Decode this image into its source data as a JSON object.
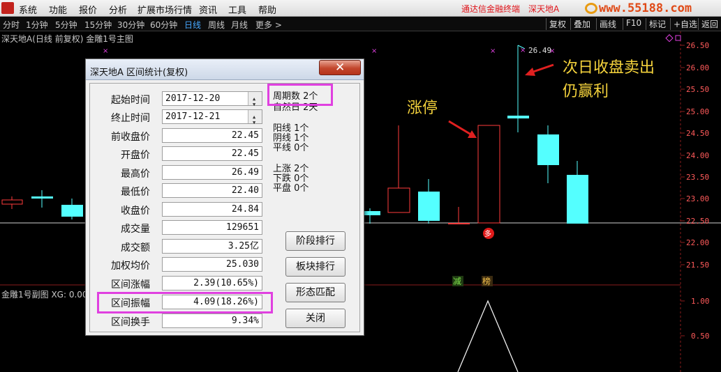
{
  "menu": {
    "items": [
      "系统",
      "功能",
      "报价",
      "分析",
      "扩展市场行情",
      "资讯",
      "工具",
      "帮助"
    ],
    "brand_links": [
      "通达信金融终端",
      "深天地A"
    ],
    "site_watermark": "www.55188.com"
  },
  "period_bar": {
    "periods": [
      "分时",
      "1分钟",
      "5分钟",
      "15分钟",
      "30分钟",
      "60分钟",
      "日线",
      "周线",
      "月线",
      "更多 >"
    ],
    "active_period": "日线",
    "tools": [
      "复权",
      "叠加",
      "画线",
      "F10",
      "标记",
      "+自选",
      "返回"
    ]
  },
  "chart": {
    "main_title": "深天地A(日线 前复权) 金雕1号主图",
    "sub_title": "金雕1号副图 XG: 0.00",
    "price_axis": [
      "26.50",
      "26.00",
      "25.50",
      "25.00",
      "24.50",
      "24.00",
      "23.50",
      "23.00",
      "22.50",
      "22.00",
      "21.50"
    ],
    "sub_axis": [
      "1.00",
      "0.50"
    ],
    "high_label": "26.49",
    "signal_duo": "多",
    "signal_jian": "减",
    "signal_bang": "榜",
    "colors": {
      "up": "#ff3c3c",
      "down": "#54ffff",
      "axis_text": "#ff5a5a",
      "signal_marker": "#e040e0"
    }
  },
  "annotations": {
    "limit_up": "涨停",
    "next_day_line1": "次日收盘卖出",
    "next_day_line2": "仍赢利"
  },
  "dialog": {
    "title": "深天地A 区间统计(复权)",
    "close_label": "✕",
    "start_label": "起始时间",
    "start_value": "2017-12-20",
    "end_label": "终止时间",
    "end_value": "2017-12-21",
    "fields": [
      {
        "label": "前收盘价",
        "value": "22.45"
      },
      {
        "label": "开盘价",
        "value": "22.45"
      },
      {
        "label": "最高价",
        "value": "26.49"
      },
      {
        "label": "最低价",
        "value": "22.40"
      },
      {
        "label": "收盘价",
        "value": "24.84"
      },
      {
        "label": "成交量",
        "value": "129651"
      },
      {
        "label": "成交额",
        "value": "3.25亿"
      },
      {
        "label": "加权均价",
        "value": "25.030"
      },
      {
        "label": "区间涨幅",
        "value": "2.39(10.65%)"
      },
      {
        "label": "区间振幅",
        "value": "4.09(18.26%)"
      },
      {
        "label": "区间换手",
        "value": "9.34%"
      }
    ],
    "stats": {
      "period_count": "周期数 2个",
      "natural_days": "自然日 2天",
      "yang": "阳线 1个",
      "yin": "阴线 1个",
      "flat_line": "平线 0个",
      "rise": "上涨 2个",
      "fall": "下跌 0个",
      "flat": "平盘 0个"
    },
    "buttons": [
      "阶段排行",
      "板块排行",
      "形态匹配",
      "关闭"
    ]
  }
}
